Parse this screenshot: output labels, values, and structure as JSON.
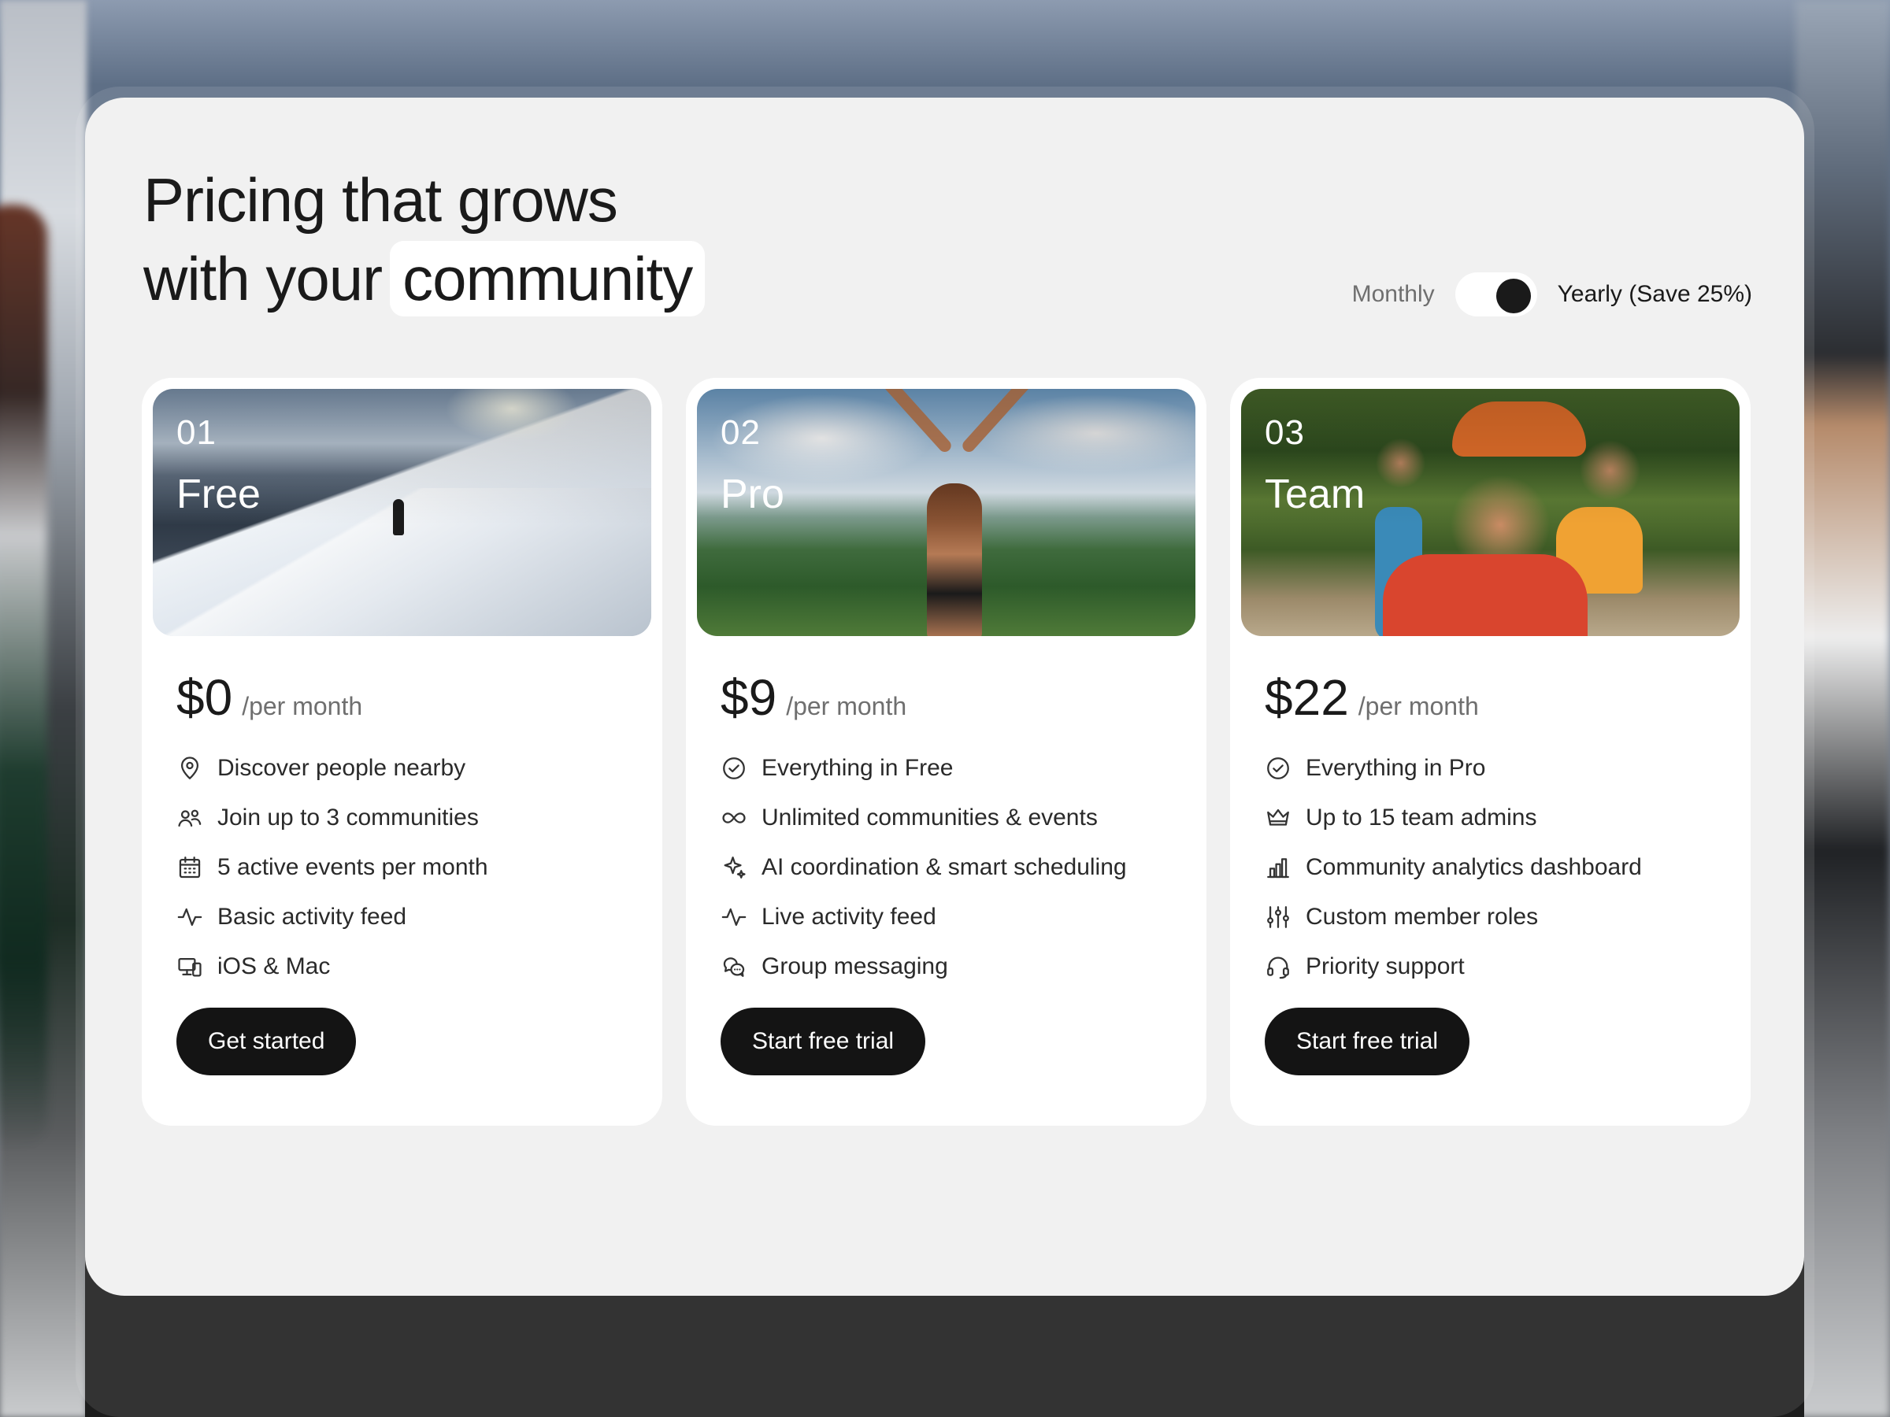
{
  "heading": {
    "line1": "Pricing that grows",
    "line2_prefix": "with your",
    "line2_highlight": "community"
  },
  "billing_toggle": {
    "monthly_label": "Monthly",
    "yearly_label": "Yearly (Save 25%)",
    "selected": "yearly"
  },
  "plans": [
    {
      "number": "01",
      "name": "Free",
      "price": "$0",
      "period": "/per month",
      "features": [
        {
          "icon": "location-pin-icon",
          "text": "Discover people nearby"
        },
        {
          "icon": "users-icon",
          "text": "Join up to 3 communities"
        },
        {
          "icon": "calendar-icon",
          "text": "5 active events per month"
        },
        {
          "icon": "activity-icon",
          "text": "Basic activity feed"
        },
        {
          "icon": "devices-icon",
          "text": "iOS & Mac"
        }
      ],
      "cta": "Get started"
    },
    {
      "number": "02",
      "name": "Pro",
      "price": "$9",
      "period": "/per month",
      "features": [
        {
          "icon": "check-circle-icon",
          "text": "Everything in Free"
        },
        {
          "icon": "infinity-icon",
          "text": "Unlimited communities & events"
        },
        {
          "icon": "sparkle-icon",
          "text": "AI coordination & smart scheduling"
        },
        {
          "icon": "activity-icon",
          "text": "Live activity feed"
        },
        {
          "icon": "chat-bubbles-icon",
          "text": "Group messaging"
        }
      ],
      "cta": "Start free trial"
    },
    {
      "number": "03",
      "name": "Team",
      "price": "$22",
      "period": "/per month",
      "features": [
        {
          "icon": "check-circle-icon",
          "text": "Everything in Pro"
        },
        {
          "icon": "crown-icon",
          "text": "Up to 15 team admins"
        },
        {
          "icon": "bar-chart-icon",
          "text": "Community analytics dashboard"
        },
        {
          "icon": "sliders-icon",
          "text": "Custom member roles"
        },
        {
          "icon": "headset-icon",
          "text": "Priority support"
        }
      ],
      "cta": "Start free trial"
    }
  ],
  "colors": {
    "panel_bg": "#f1f1f1",
    "card_bg": "#ffffff",
    "button_bg": "#141414",
    "text_primary": "#1a1a1a",
    "text_muted": "#6f6f6f"
  }
}
